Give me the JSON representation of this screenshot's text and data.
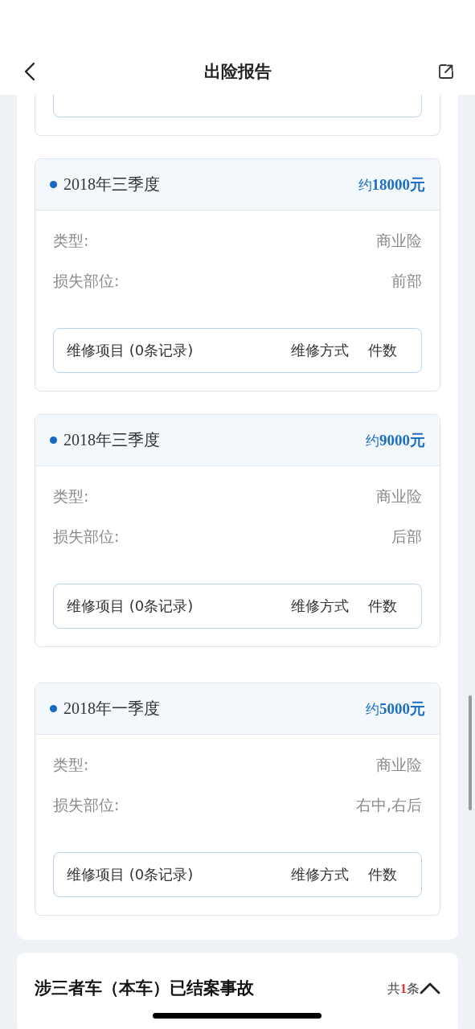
{
  "nav": {
    "title": "出险报告"
  },
  "claims": [
    {
      "period": "2018年三季度",
      "amount_prefix": "约",
      "amount": "18000元",
      "fields": [
        {
          "label": "类型:",
          "value": "商业险"
        },
        {
          "label": "损失部位:",
          "value": "前部"
        }
      ],
      "repair_header": {
        "item": "维修项目 (0条记录)",
        "method": "维修方式",
        "count": "件数"
      }
    },
    {
      "period": "2018年三季度",
      "amount_prefix": "约",
      "amount": "9000元",
      "fields": [
        {
          "label": "类型:",
          "value": "商业险"
        },
        {
          "label": "损失部位:",
          "value": "后部"
        }
      ],
      "repair_header": {
        "item": "维修项目 (0条记录)",
        "method": "维修方式",
        "count": "件数"
      }
    },
    {
      "period": "2018年一季度",
      "amount_prefix": "约",
      "amount": "5000元",
      "fields": [
        {
          "label": "类型:",
          "value": "商业险"
        },
        {
          "label": "损失部位:",
          "value": "右中,右后"
        }
      ],
      "repair_header": {
        "item": "维修项目 (0条记录)",
        "method": "维修方式",
        "count": "件数"
      }
    }
  ],
  "section": {
    "title": "涉三者车（本车）已结案事故",
    "count_prefix": "共",
    "count": "1",
    "count_suffix": "条",
    "expanded": true
  }
}
